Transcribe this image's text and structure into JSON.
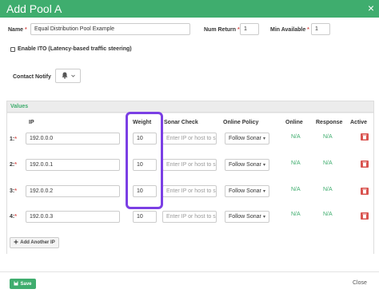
{
  "modal": {
    "title": "Add Pool A",
    "close_glyph": "×"
  },
  "form": {
    "name_label": "Name",
    "name_value": "Equal Distribution Pool Example",
    "num_return_label": "Num Return",
    "num_return_value": "1",
    "num_available_label": "Min Available",
    "num_available_value": "1",
    "ito_label": "Enable ITO (Latency-based traffic steering)",
    "contact_notify_label": "Contact Notify",
    "required_mark": "*"
  },
  "values_panel": {
    "title": "Values",
    "headers": {
      "ip": "IP",
      "weight": "Weight",
      "sonar_check": "Sonar Check",
      "online_policy": "Online Policy",
      "online": "Online",
      "response": "Response",
      "active": "Active"
    },
    "sonar_placeholder": "Enter IP or host to se",
    "rows": [
      {
        "label": "1:",
        "ip": "192.0.0.0",
        "weight": "10",
        "policy": "Follow Sonar",
        "online": "N/A",
        "response": "N/A"
      },
      {
        "label": "2:",
        "ip": "192.0.0.1",
        "weight": "10",
        "policy": "Follow Sonar",
        "online": "N/A",
        "response": "N/A"
      },
      {
        "label": "3:",
        "ip": "192.0.0.2",
        "weight": "10",
        "policy": "Follow Sonar",
        "online": "N/A",
        "response": "N/A"
      },
      {
        "label": "4:",
        "ip": "192.0.0.3",
        "weight": "10",
        "policy": "Follow Sonar",
        "online": "N/A",
        "response": "N/A"
      }
    ],
    "add_button_label": "Add Another IP"
  },
  "footer": {
    "save_label": "Save",
    "close_label": "Close"
  },
  "colors": {
    "brand": "#3fad6e",
    "highlight": "#7b3fe4",
    "danger": "#d9534f"
  },
  "icons": {
    "bell": "bell-icon",
    "trash": "trash-icon",
    "plus": "plus-icon",
    "save": "save-icon"
  }
}
